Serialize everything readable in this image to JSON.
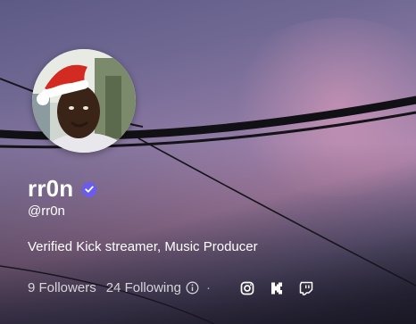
{
  "profile": {
    "display_name": "rr0n",
    "handle": "@rr0n",
    "bio": "Verified Kick streamer, Music Producer",
    "verified_badge_color": "#6b5cf0"
  },
  "stats": {
    "followers_count": "9",
    "followers_label": "Followers",
    "following_count": "24",
    "following_label": "Following"
  },
  "social_links": [
    {
      "icon": "instagram-icon"
    },
    {
      "icon": "kick-icon"
    },
    {
      "icon": "twitch-icon"
    }
  ]
}
